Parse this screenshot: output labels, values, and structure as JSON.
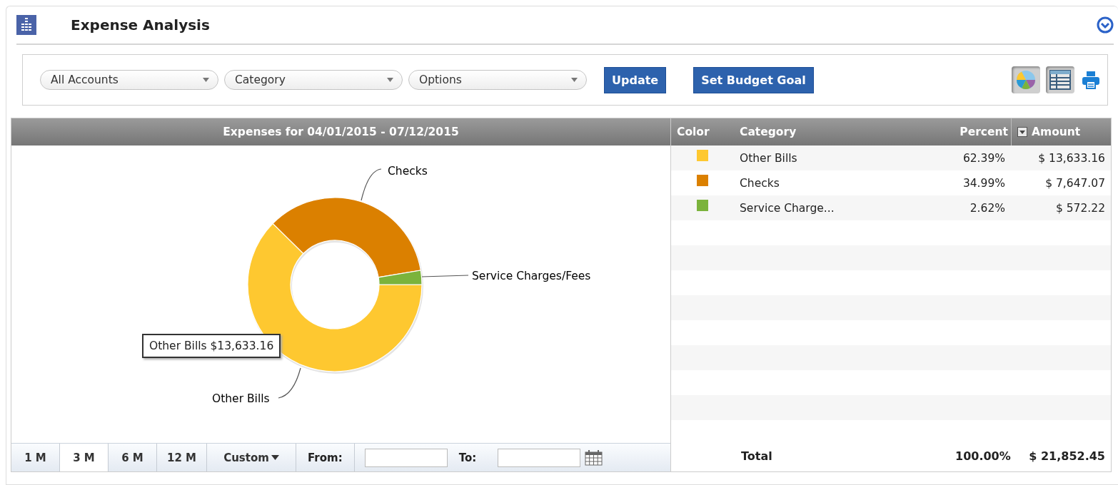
{
  "widget": {
    "title": "Expense Analysis"
  },
  "toolbar": {
    "dropdowns": [
      {
        "value": "All Accounts"
      },
      {
        "value": "Category"
      },
      {
        "value": "Options"
      }
    ],
    "buttons": [
      {
        "label": "Update"
      },
      {
        "label": "Set Budget Goal"
      }
    ]
  },
  "chart": {
    "title": "Expenses for 04/01/2015 - 07/12/2015",
    "tooltip": "Other Bills $13,633.16",
    "chart_data": {
      "type": "donut",
      "categories": [
        "Other Bills",
        "Checks",
        "Service Charges/Fees"
      ],
      "values": [
        62.39,
        34.99,
        2.62
      ]
    }
  },
  "periods": [
    {
      "label": "1 M",
      "selected": false
    },
    {
      "label": "3 M",
      "selected": true
    },
    {
      "label": "6 M",
      "selected": false
    },
    {
      "label": "12 M",
      "selected": false
    }
  ],
  "custom": {
    "label": "Custom"
  },
  "range": {
    "from_label": "From:",
    "to_label": "To:"
  },
  "table": {
    "columns": [
      "Color",
      "Category",
      "Percent",
      "Amount"
    ],
    "rows": [
      {
        "color": "#fec830",
        "category": "Other Bills",
        "percent": "62.39%",
        "amount": "$ 13,633.16"
      },
      {
        "color": "#db8000",
        "category": "Checks",
        "percent": "34.99%",
        "amount": "$ 7,647.07"
      },
      {
        "color": "#7bb33c",
        "category": "Service Charge...",
        "percent": "2.62%",
        "amount": "$ 572.22"
      }
    ],
    "total": {
      "label": "Total",
      "percent": "100.00%",
      "amount": "$ 21,852.45"
    }
  }
}
